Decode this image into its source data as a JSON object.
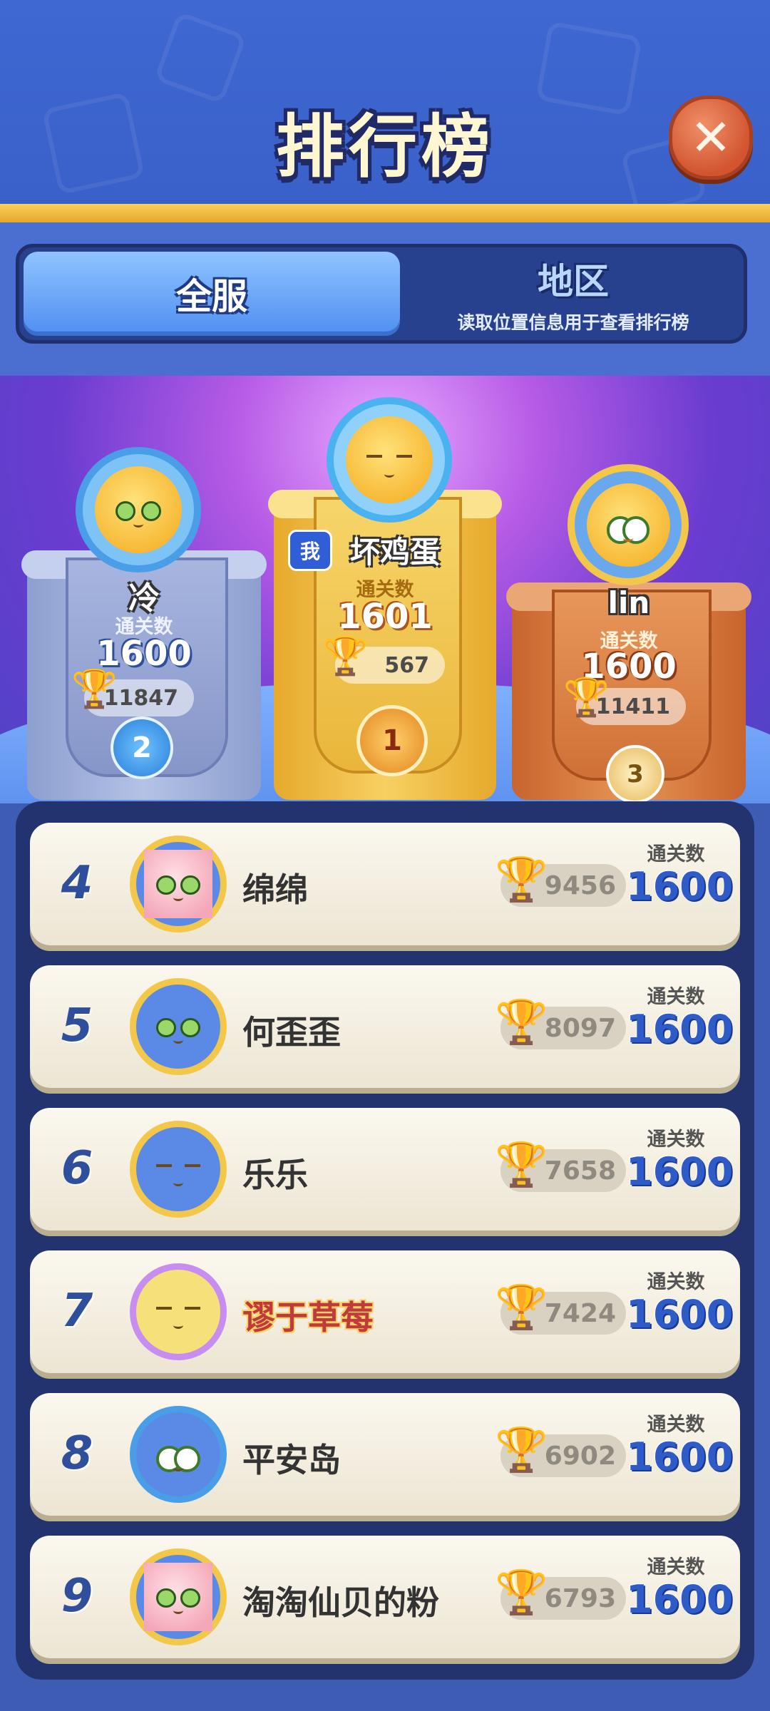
{
  "header": {
    "title": "排行榜",
    "close_icon": "close-x-icon"
  },
  "tabs": {
    "global": {
      "label": "全服",
      "active": true
    },
    "region": {
      "label": "地区",
      "sublabel": "读取位置信息用于查看排行榜"
    }
  },
  "podium": {
    "first": {
      "rank": "1",
      "name": "坏鸡蛋",
      "me_badge": "我",
      "label": "通关数",
      "score": "1601",
      "trophies": "567",
      "color": "#f2c23c"
    },
    "second": {
      "rank": "2",
      "name": "冷",
      "label": "通关数",
      "score": "1600",
      "trophies": "11847",
      "color": "#9fb0d6"
    },
    "third": {
      "rank": "3",
      "name": "lin",
      "label": "通关数",
      "score": "1600",
      "trophies": "11411",
      "color": "#d9793f"
    }
  },
  "list": [
    {
      "rank": "4",
      "name": "绵绵",
      "trophies": "9456",
      "label": "通关数",
      "score": "1600"
    },
    {
      "rank": "5",
      "name": "何歪歪",
      "trophies": "8097",
      "label": "通关数",
      "score": "1600"
    },
    {
      "rank": "6",
      "name": "乐乐",
      "trophies": "7658",
      "label": "通关数",
      "score": "1600"
    },
    {
      "rank": "7",
      "name": "谬于草莓",
      "trophies": "7424",
      "label": "通关数",
      "score": "1600"
    },
    {
      "rank": "8",
      "name": "平安岛",
      "trophies": "6902",
      "label": "通关数",
      "score": "1600"
    },
    {
      "rank": "9",
      "name": "淘淘仙贝的粉",
      "trophies": "6793",
      "label": "通关数",
      "score": "1600"
    }
  ]
}
